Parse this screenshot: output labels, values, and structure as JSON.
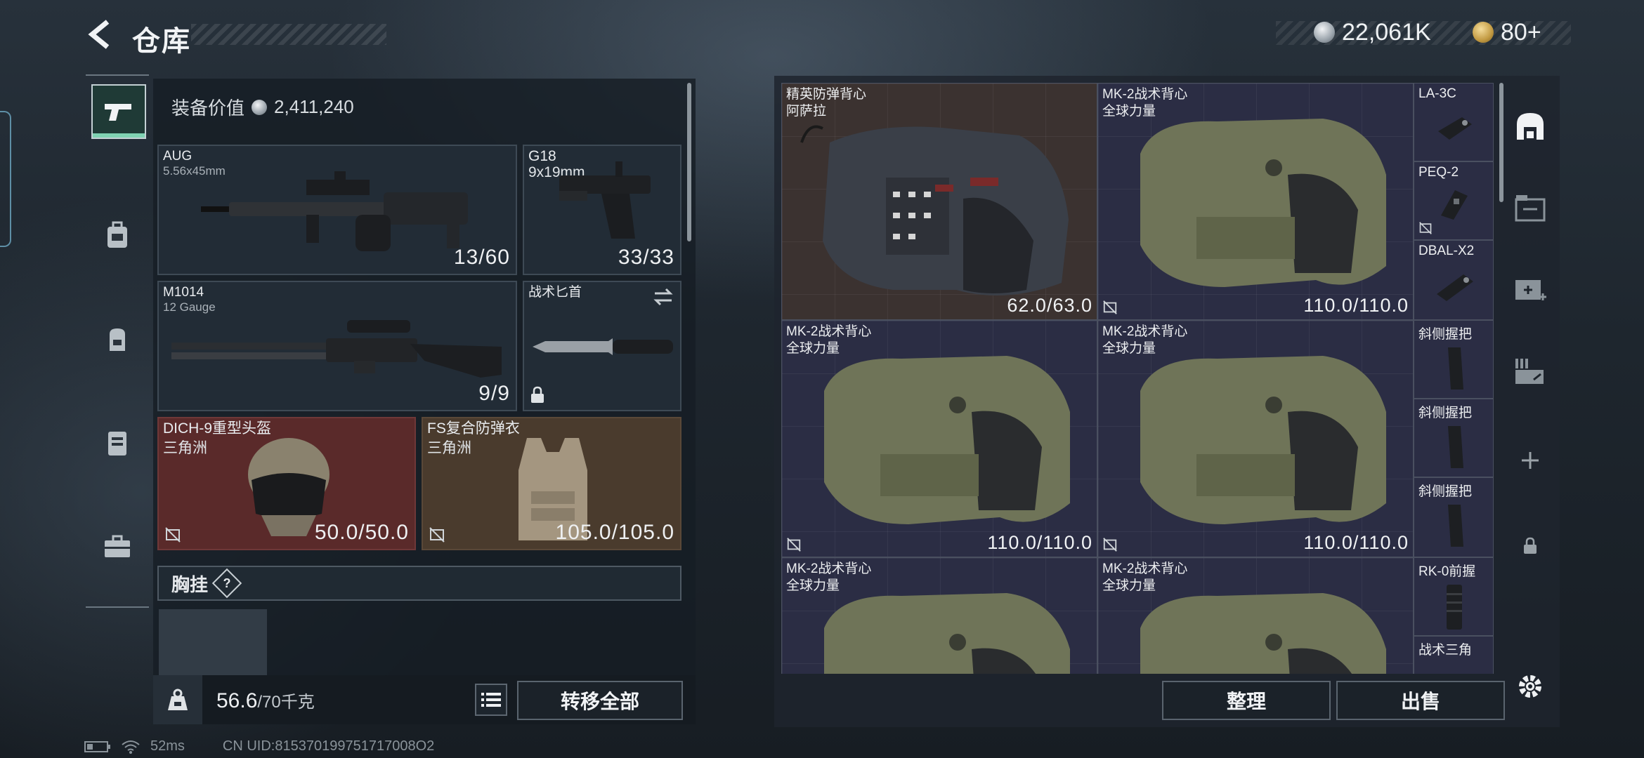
{
  "header": {
    "title": "仓库",
    "silver_amount": "22,061K",
    "gold_amount": "80+",
    "plus": "+"
  },
  "loadout": {
    "equipment_value_label": "装备价值",
    "equipment_value": "2,411,240",
    "slots": [
      {
        "name": "AUG",
        "sub": "5.56x45mm",
        "count": "13/60"
      },
      {
        "name": "G18",
        "sub": "9x19mm",
        "count": "33/33"
      },
      {
        "name": "M1014",
        "sub": "12 Gauge",
        "count": "9/9"
      },
      {
        "name": "战术匕首",
        "sub": "",
        "count": ""
      },
      {
        "name": "DICH-9重型头盔",
        "sub": "三角洲",
        "count": "50.0/50.0"
      },
      {
        "name": "FS复合防弹衣",
        "sub": "三角洲",
        "count": "105.0/105.0"
      }
    ],
    "chest_label": "胸挂",
    "chest_help": "?",
    "weight_current": "56.6",
    "weight_max": "/70千克",
    "transfer_all": "转移全部"
  },
  "storage": {
    "items": [
      {
        "name": "精英防弹背心",
        "sub": "阿萨拉",
        "count": "62.0/63.0"
      },
      {
        "name": "MK-2战术背心",
        "sub": "全球力量",
        "count": "110.0/110.0"
      },
      {
        "name": "MK-2战术背心",
        "sub": "全球力量",
        "count": "110.0/110.0"
      },
      {
        "name": "MK-2战术背心",
        "sub": "全球力量",
        "count": "110.0/110.0"
      },
      {
        "name": "MK-2战术背心",
        "sub": "全球力量",
        "count": ""
      },
      {
        "name": "MK-2战术背心",
        "sub": "全球力量",
        "count": ""
      }
    ],
    "small_items": [
      "LA-3C",
      "PEQ-2",
      "DBAL-X2",
      "斜侧握把",
      "斜侧握把",
      "斜侧握把",
      "RK-0前握",
      "战术三角"
    ],
    "sort_label": "整理",
    "sell_label": "出售"
  },
  "status": {
    "ping": "52ms",
    "uid": "CN UID:815370199751717008O2"
  },
  "colors": {
    "background": "#1c232b",
    "panel": "#222c36",
    "storage_cell": "#2b2d44",
    "helmet_slot": "#5a2a2a",
    "armor_slot": "#4a3b2d",
    "accent_green": "#7fd2b2"
  },
  "icons": [
    "back-arrow-icon",
    "silver-coin-icon",
    "gold-coin-icon",
    "pistol-icon",
    "backpack-icon",
    "bag-icon",
    "vest-icon",
    "toolbox-icon",
    "lock-icon",
    "swap-icon",
    "no-insure-icon",
    "weight-icon",
    "list-icon",
    "storage-icon",
    "crate-icon",
    "medkit-icon",
    "ammo-icon",
    "plus-icon",
    "settings-icon",
    "battery-icon",
    "wifi-icon"
  ]
}
